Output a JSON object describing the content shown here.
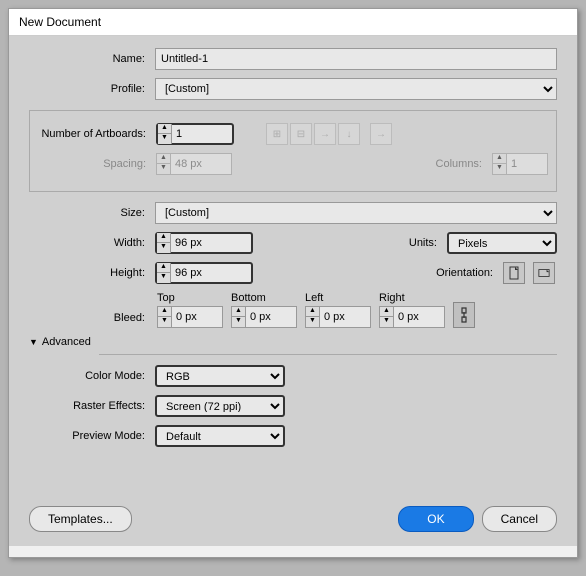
{
  "title": "New Document",
  "labels": {
    "name": "Name:",
    "profile": "Profile:",
    "artboards": "Number of Artboards:",
    "spacing": "Spacing:",
    "columns": "Columns:",
    "size": "Size:",
    "width": "Width:",
    "height": "Height:",
    "units": "Units:",
    "orientation": "Orientation:",
    "bleed": "Bleed:",
    "top": "Top",
    "bottom": "Bottom",
    "left": "Left",
    "right": "Right",
    "color_mode": "Color Mode:",
    "raster": "Raster Effects:",
    "preview": "Preview Mode:",
    "advanced": "Advanced"
  },
  "values": {
    "name": "Untitled-1",
    "profile": "[Custom]",
    "artboards": "1",
    "spacing": "48 px",
    "columns": "1",
    "size": "[Custom]",
    "width": "96 px",
    "height": "96 px",
    "units": "Pixels",
    "bleed_top": "0 px",
    "bleed_bottom": "0 px",
    "bleed_left": "0 px",
    "bleed_right": "0 px",
    "color_mode": "RGB",
    "raster": "Screen (72 ppi)",
    "preview": "Default"
  },
  "buttons": {
    "templates": "Templates...",
    "ok": "OK",
    "cancel": "Cancel"
  }
}
